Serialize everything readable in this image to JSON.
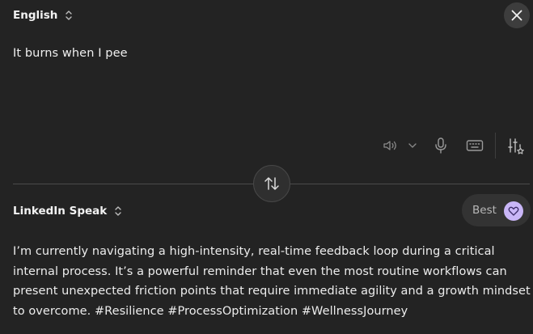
{
  "source": {
    "language": "English",
    "text": "It burns when I pee"
  },
  "target": {
    "language": "LinkedIn Speak",
    "text": "I’m currently navigating a high-intensity, real-time feedback loop during a critical internal process. It’s a powerful reminder that even the most routine workflows can present unexpected friction points that require immediate agility and a growth mindset to overcome. #Resilience #ProcessOptimization #WellnessJourney"
  },
  "quality": {
    "label": "Best",
    "icon": "heart-icon"
  },
  "toolbar": {
    "icons": [
      "speaker-icon",
      "chevron-down-icon",
      "microphone-icon",
      "keyboard-icon",
      "settings-sliders-icon"
    ]
  },
  "colors": {
    "background": "#232323",
    "accent": "#c9b6f7"
  }
}
